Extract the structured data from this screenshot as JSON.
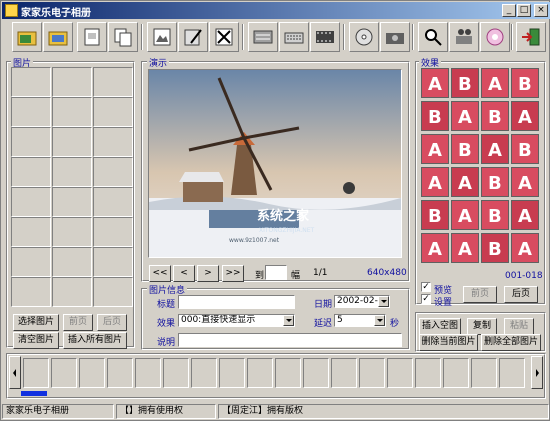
{
  "window": {
    "title": "家家乐电子相册"
  },
  "toolbar": {
    "buttons": [
      "open-folder-icon",
      "folder-icon",
      "properties-icon",
      "copy-icon",
      "image-icon",
      "edit-icon",
      "delete-icon",
      "tools-icon",
      "keyboard-icon",
      "film-icon",
      "cd-icon",
      "camera-icon",
      "search-icon",
      "projector-icon",
      "sound-icon",
      "exit-icon"
    ]
  },
  "pictures": {
    "label": "图片",
    "select_btn": "选择图片",
    "prev_btn": "前页",
    "next_btn": "后页",
    "clear_btn": "清空图片",
    "insert_all_btn": "插入所有图片"
  },
  "preview": {
    "label": "演示",
    "watermark_title": "系统之家",
    "watermark_sub": "XITONGZHIJIA.NET",
    "watermark_url": "www.9z1007.net",
    "nav_buttons": [
      "<<",
      "<",
      ">",
      ">>"
    ],
    "goto_label": "到",
    "goto_value": "",
    "frame_label": "幅",
    "page_indicator": "1/1",
    "resolution": "640x480"
  },
  "info": {
    "label": "图片信息",
    "title_label": "标题",
    "title_value": "",
    "date_label": "日期",
    "date_value": "2002-02-08",
    "effect_label": "效果",
    "effect_value": "000:直接快速显示",
    "delay_label": "延迟",
    "delay_value": "5",
    "delay_unit": "秒",
    "desc_label": "说明",
    "desc_value": ""
  },
  "effects": {
    "label": "效果",
    "letters": [
      "A",
      "B",
      "A",
      "B",
      "B",
      "A",
      "B",
      "A",
      "A",
      "B",
      "A",
      "B",
      "A",
      "A",
      "B",
      "A",
      "B",
      "A",
      "B",
      "A",
      "A",
      "A",
      "B",
      "A"
    ],
    "range": "001-018",
    "preview_label": "预览",
    "preview_checked": true,
    "settings_label": "设置",
    "settings_checked": true,
    "prev_btn": "前页",
    "next_btn": "后页"
  },
  "actions": {
    "insert_blank": "插入空图",
    "copy": "复制",
    "paste": "粘贴",
    "delete_current": "删除当前图片",
    "delete_all": "删除全部图片"
  },
  "status": {
    "app": "家家乐电子相册",
    "usage": "【】拥有使用权",
    "copyright": "【周定江】拥有版权"
  },
  "colors": {
    "title_start": "#0a246a",
    "title_end": "#a6caf0",
    "label_blue": "#1010a0",
    "effect_red": "#c8283c"
  }
}
